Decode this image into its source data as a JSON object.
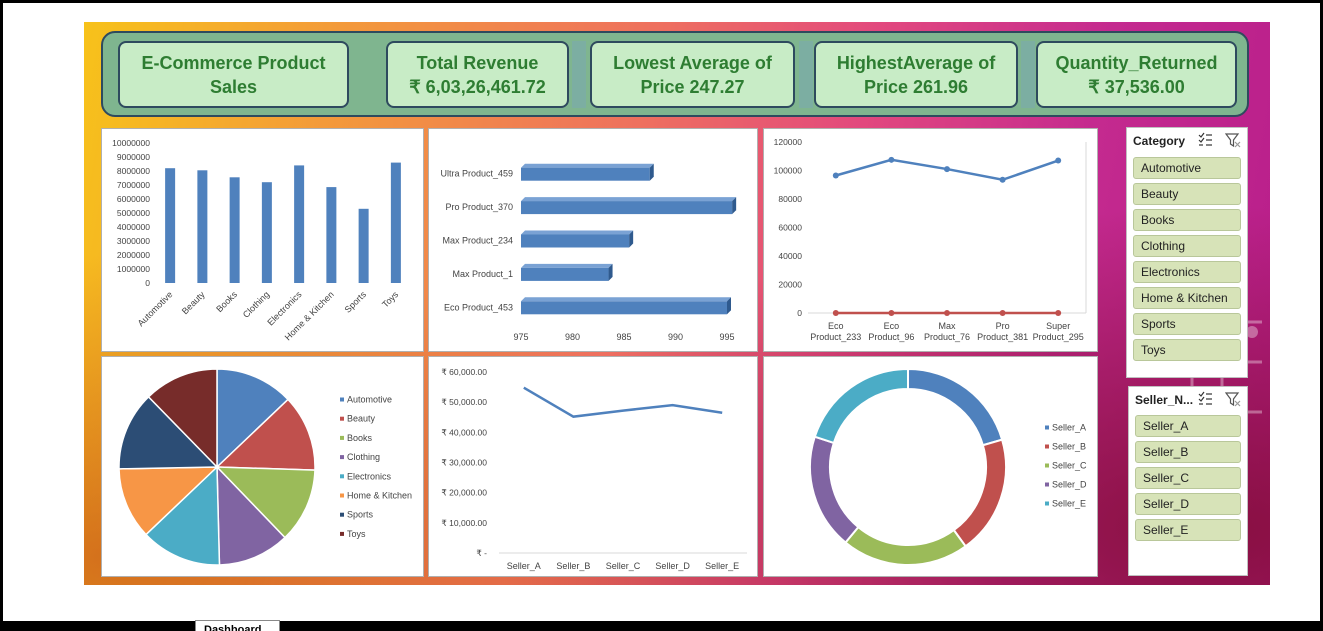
{
  "kpis": {
    "title": {
      "line1": "E-Commerce Product",
      "line2": "Sales"
    },
    "revenue": {
      "line1": "Total Revenue",
      "line2": "₹  6,03,26,461.72"
    },
    "lowest": {
      "line1": "Lowest Average of",
      "line2": "Price   247.27"
    },
    "highest": {
      "line1": "HighestAverage of",
      "line2": "Price  261.96"
    },
    "returned": {
      "line1": "Quantity_Returned",
      "line2": "₹ 37,536.00"
    }
  },
  "sheet_tab": {
    "label": "Dashboard"
  },
  "colors": {
    "bar": "#4f81bd",
    "red": "#c0504d",
    "green": "#9bbb59",
    "purple": "#8064a2",
    "teal": "#4bacc6",
    "orange": "#f79646",
    "navy": "#2c4d75",
    "maroon": "#772c2a",
    "kpi_text": "#2e7d32",
    "kpi_fill": "#c8ecc6",
    "slicer_item": "#d7e3b8"
  },
  "slicers": {
    "category": {
      "title": "Category",
      "items": [
        "Automotive",
        "Beauty",
        "Books",
        "Clothing",
        "Electronics",
        "Home & Kitchen",
        "Sports",
        "Toys"
      ]
    },
    "seller": {
      "title": "Seller_N...",
      "items": [
        "Seller_A",
        "Seller_B",
        "Seller_C",
        "Seller_D",
        "Seller_E"
      ]
    },
    "icons": [
      "multi-select-icon",
      "clear-filter-icon"
    ]
  },
  "chart_data": [
    {
      "type": "bar",
      "categories": [
        "Automotive",
        "Beauty",
        "Books",
        "Clothing",
        "Electronics",
        "Home & Kitchen",
        "Sports",
        "Toys"
      ],
      "values": [
        8200000,
        8050000,
        7550000,
        7200000,
        8400000,
        6850000,
        5300000,
        8600000
      ],
      "ylim": [
        0,
        10000000
      ],
      "yticks": [
        "10000000",
        "9000000",
        "8000000",
        "7000000",
        "6000000",
        "5000000",
        "4000000",
        "3000000",
        "2000000",
        "1000000",
        "0"
      ],
      "grid": false
    },
    {
      "type": "bar",
      "orientation": "horizontal",
      "categories": [
        "Ultra Product_459",
        "Pro Product_370",
        "Max Product_234",
        "Max Product_1",
        "Eco Product_453"
      ],
      "values": [
        987.5,
        995.5,
        985.5,
        983.5,
        995
      ],
      "xlim": [
        975,
        995
      ],
      "xticks": [
        "975",
        "980",
        "985",
        "990",
        "995"
      ]
    },
    {
      "type": "line",
      "categories": [
        "Eco Product_233",
        "Eco Product_96",
        "Max Product_76",
        "Pro Product_381",
        "Super Product_295"
      ],
      "tick_lines": [
        [
          "Eco",
          "Product_233"
        ],
        [
          "Eco",
          "Product_96"
        ],
        [
          "Max",
          "Product_76"
        ],
        [
          "Pro",
          "Product_381"
        ],
        [
          "Super",
          "Product_295"
        ]
      ],
      "series": [
        {
          "values": [
            96500,
            107500,
            101000,
            93500,
            107000
          ]
        },
        {
          "values": [
            0,
            0,
            0,
            0,
            0
          ]
        }
      ],
      "ylim": [
        0,
        120000
      ],
      "yticks": [
        "120000",
        "100000",
        "80000",
        "60000",
        "40000",
        "20000",
        "0"
      ]
    },
    {
      "type": "pie",
      "labels": [
        "Automotive",
        "Beauty",
        "Books",
        "Clothing",
        "Electronics",
        "Home & Kitchen",
        "Sports",
        "Toys"
      ],
      "values": [
        12.9,
        12.6,
        12.3,
        11.8,
        13.3,
        11.8,
        13.0,
        12.3
      ],
      "legend_position": "right"
    },
    {
      "type": "line",
      "categories": [
        "Seller_A",
        "Seller_B",
        "Seller_C",
        "Seller_D",
        "Seller_E"
      ],
      "values": [
        54800,
        45200,
        47200,
        49000,
        46500
      ],
      "ylim": [
        0,
        60000
      ],
      "yticks": [
        "₹ 60,000.00",
        "₹ 50,000.00",
        "₹ 40,000.00",
        "₹ 30,000.00",
        "₹ 20,000.00",
        "₹ 10,000.00",
        "₹ -"
      ]
    },
    {
      "type": "pie",
      "variant": "doughnut",
      "labels": [
        "Seller_A",
        "Seller_B",
        "Seller_C",
        "Seller_D",
        "Seller_E"
      ],
      "values": [
        20.5,
        19.5,
        21,
        19,
        20
      ],
      "legend_position": "right"
    }
  ]
}
